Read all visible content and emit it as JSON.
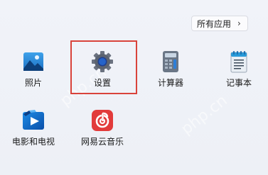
{
  "header": {
    "all_apps_label": "所有应用",
    "chevron": "›"
  },
  "apps": [
    {
      "label": "照片",
      "icon": "photos-icon"
    },
    {
      "label": "设置",
      "icon": "settings-gear-icon"
    },
    {
      "label": "计算器",
      "icon": "calculator-icon"
    },
    {
      "label": "记事本",
      "icon": "notepad-icon"
    },
    {
      "label": "电影和电视",
      "icon": "movies-tv-icon"
    },
    {
      "label": "网易云音乐",
      "icon": "netease-music-icon"
    }
  ],
  "watermark": "php.cn",
  "colors": {
    "highlight_border": "#d9433b",
    "background": "#eef1f7",
    "netease_red": "#e23b3b"
  }
}
